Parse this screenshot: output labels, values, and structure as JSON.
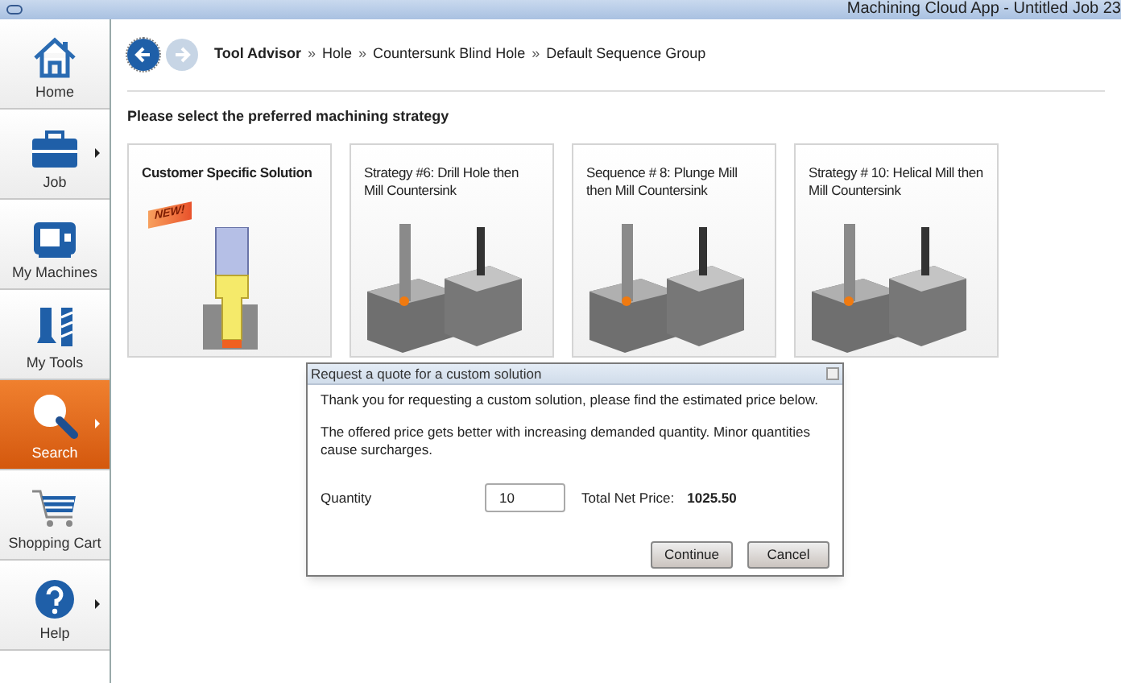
{
  "window": {
    "title": "Machining Cloud App - Untitled Job 23"
  },
  "sidebar": {
    "items": [
      {
        "label": "Home",
        "submenu": false,
        "selected": false
      },
      {
        "label": "Job",
        "submenu": true,
        "selected": false
      },
      {
        "label": "My Machines",
        "submenu": false,
        "selected": false
      },
      {
        "label": "My Tools",
        "submenu": false,
        "selected": false
      },
      {
        "label": "Search",
        "submenu": true,
        "selected": true
      },
      {
        "label": "Shopping Cart",
        "submenu": false,
        "selected": false
      },
      {
        "label": "Help",
        "submenu": true,
        "selected": false
      }
    ]
  },
  "navigation": {
    "back_disabled": false,
    "forward_disabled": true
  },
  "breadcrumb": [
    "Tool Advisor",
    "Hole",
    "Countersunk Blind Hole",
    "Default Sequence Group"
  ],
  "breadcrumb_separator": "»",
  "heading": "Please select the preferred machining strategy",
  "cards": [
    {
      "kind": "custom",
      "title": "Customer Specific Solution",
      "badge": "NEW!"
    },
    {
      "kind": "strategy",
      "title": "Strategy #6: Drill Hole then Mill Countersink"
    },
    {
      "kind": "strategy",
      "title": "Sequence # 8: Plunge Mill then Mill Countersink"
    },
    {
      "kind": "strategy",
      "title": "Strategy # 10: Helical Mill then Mill Countersink"
    }
  ],
  "dialog": {
    "title": "Request a quote for a custom solution",
    "paragraphs": [
      "Thank you for requesting a custom solution, please find the estimated price below.",
      "The offered price gets better with increasing demanded quantity. Minor quantities cause surcharges."
    ],
    "quantity_label": "Quantity",
    "quantity_value": "10",
    "price_label": "Total Net Price:",
    "price_value": "1025.50",
    "buttons": [
      "Continue",
      "Cancel"
    ]
  }
}
